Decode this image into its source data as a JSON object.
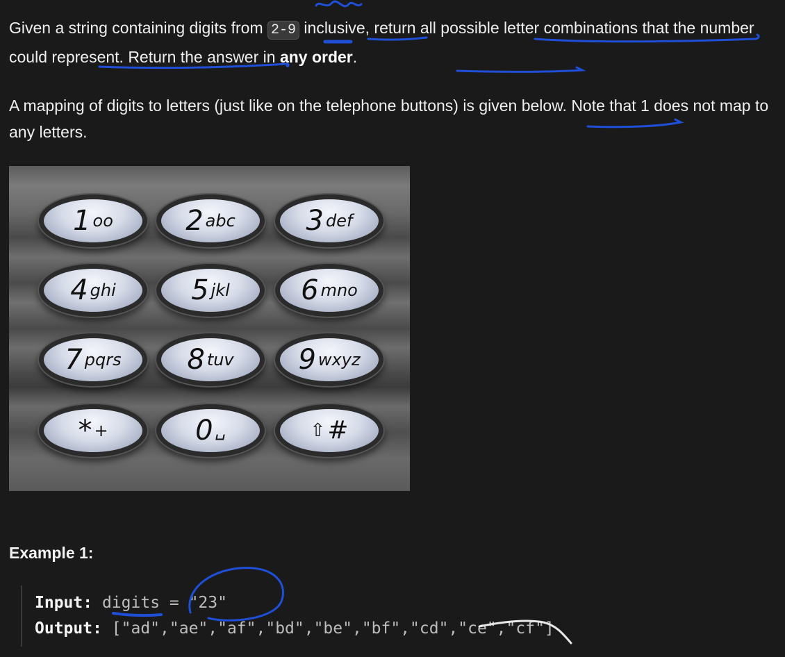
{
  "description": {
    "p1_part1": "Given a string containing digits from ",
    "p1_code": "2-9",
    "p1_part2": " inclusive, return all possible letter combinations that the number could represent. Return the answer in ",
    "p1_bold": "any order",
    "p1_end": ".",
    "p2": "A mapping of digits to letters (just like on the telephone buttons) is given below. Note that 1 does not map to any letters."
  },
  "keypad": {
    "keys": [
      {
        "digit": "1",
        "letters": "oo"
      },
      {
        "digit": "2",
        "letters": "abc"
      },
      {
        "digit": "3",
        "letters": "def"
      },
      {
        "digit": "4",
        "letters": "ghi"
      },
      {
        "digit": "5",
        "letters": "jkl"
      },
      {
        "digit": "6",
        "letters": "mno"
      },
      {
        "digit": "7",
        "letters": "pqrs"
      },
      {
        "digit": "8",
        "letters": "tuv"
      },
      {
        "digit": "9",
        "letters": "wxyz"
      },
      {
        "digit": "*",
        "letters": "+"
      },
      {
        "digit": "0",
        "letters": "␣"
      },
      {
        "digit": "⇧",
        "letters": "#"
      }
    ]
  },
  "example": {
    "title": "Example 1:",
    "input_label": "Input:",
    "input_value": "digits = \"23\"",
    "output_label": "Output:",
    "output_value": "[\"ad\",\"ae\",\"af\",\"bd\",\"be\",\"bf\",\"cd\",\"ce\",\"cf\"]"
  },
  "colors": {
    "background": "#1a1a1a",
    "annotation_ink": "#1f4fd6"
  }
}
